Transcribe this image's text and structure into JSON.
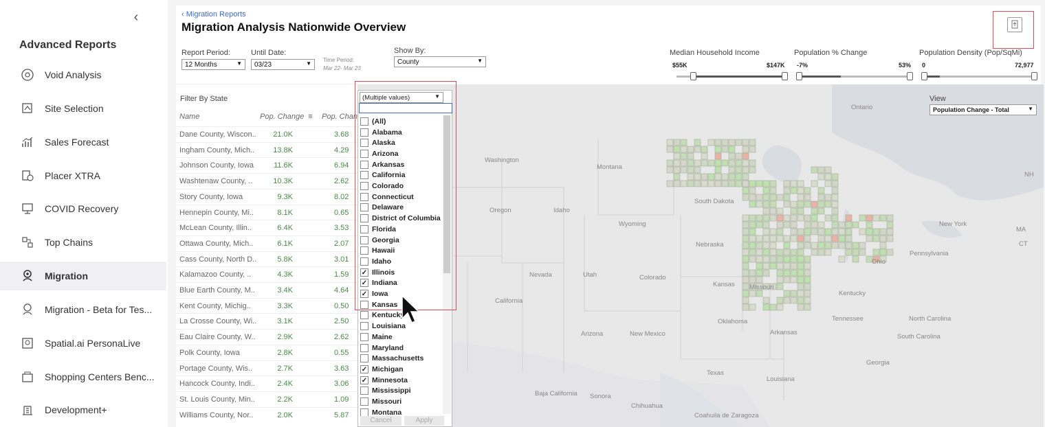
{
  "sidebar": {
    "collapse_glyph": "‹",
    "title": "Advanced Reports",
    "items": [
      {
        "label": "Void Analysis",
        "icon": "void-analysis-icon"
      },
      {
        "label": "Site Selection",
        "icon": "site-selection-icon"
      },
      {
        "label": "Sales Forecast",
        "icon": "sales-forecast-icon"
      },
      {
        "label": "Placer XTRA",
        "icon": "placer-xtra-icon"
      },
      {
        "label": "COVID Recovery",
        "icon": "covid-recovery-icon"
      },
      {
        "label": "Top Chains",
        "icon": "top-chains-icon"
      },
      {
        "label": "Migration",
        "icon": "migration-icon",
        "active": true
      },
      {
        "label": "Migration - Beta for Tes...",
        "icon": "migration-beta-icon"
      },
      {
        "label": "Spatial.ai PersonaLive",
        "icon": "persona-icon"
      },
      {
        "label": "Shopping Centers Benc...",
        "icon": "shopping-centers-icon"
      },
      {
        "label": "Development+",
        "icon": "development-icon"
      }
    ]
  },
  "header": {
    "back_label": "‹ Migration Reports",
    "title": "Migration Analysis  Nationwide Overview"
  },
  "controls": {
    "report_period_label": "Report Period:",
    "report_period_value": "12 Months",
    "until_date_label": "Until Date:",
    "until_date_value": "03/23",
    "time_period_label": "Time Period:",
    "time_period_value": "Mar 22- Mar 23",
    "show_by_label": "Show By:",
    "show_by_value": "County",
    "income_label": "Median Household Income",
    "income_min": "$55K",
    "income_max": "$147K",
    "pop_change_label": "Population % Change",
    "pop_change_min": "-7%",
    "pop_change_max": "53%",
    "density_label": "Population Density (Pop/SqMi)",
    "density_min": "0",
    "density_max": "72,977"
  },
  "filter": {
    "label": "Filter By State"
  },
  "table": {
    "col_name": "Name",
    "col_change": "Pop. Change",
    "col_pct": "Pop. Chang",
    "rows": [
      {
        "name": "Dane County, Wiscon..",
        "change": "21.0K",
        "pct": "3.68"
      },
      {
        "name": "Ingham County, Mich..",
        "change": "13.8K",
        "pct": "4.29"
      },
      {
        "name": "Johnson County, Iowa",
        "change": "11.6K",
        "pct": "6.94"
      },
      {
        "name": "Washtenaw County, ..",
        "change": "10.3K",
        "pct": "2.62"
      },
      {
        "name": "Story County, Iowa",
        "change": "9.3K",
        "pct": "8.02"
      },
      {
        "name": "Hennepin County, Mi..",
        "change": "8.1K",
        "pct": "0.65"
      },
      {
        "name": "McLean County, Illin..",
        "change": "6.4K",
        "pct": "3.53"
      },
      {
        "name": "Ottawa County, Mich..",
        "change": "6.1K",
        "pct": "2.07"
      },
      {
        "name": "Cass County, North D..",
        "change": "5.8K",
        "pct": "3.01"
      },
      {
        "name": "Kalamazoo County, ..",
        "change": "4.3K",
        "pct": "1.59"
      },
      {
        "name": "Blue Earth County, M..",
        "change": "3.4K",
        "pct": "4.64"
      },
      {
        "name": "Kent County, Michig..",
        "change": "3.3K",
        "pct": "0.50"
      },
      {
        "name": "La Crosse County, Wi..",
        "change": "3.1K",
        "pct": "2.50"
      },
      {
        "name": "Eau Claire County, W..",
        "change": "2.9K",
        "pct": "2.62"
      },
      {
        "name": "Polk County, Iowa",
        "change": "2.8K",
        "pct": "0.55"
      },
      {
        "name": "Portage County, Wis..",
        "change": "2.7K",
        "pct": "3.63"
      },
      {
        "name": "Hancock County, Indi..",
        "change": "2.4K",
        "pct": "3.06"
      },
      {
        "name": "St. Louis County, Min..",
        "change": "2.2K",
        "pct": "1.09"
      },
      {
        "name": "Williams County, Nor..",
        "change": "2.0K",
        "pct": "5.87"
      }
    ]
  },
  "dropdown": {
    "value": "(Multiple values)",
    "options": [
      {
        "label": "(All)",
        "checked": false
      },
      {
        "label": "Alabama",
        "checked": false
      },
      {
        "label": "Alaska",
        "checked": false
      },
      {
        "label": "Arizona",
        "checked": false
      },
      {
        "label": "Arkansas",
        "checked": false
      },
      {
        "label": "California",
        "checked": false
      },
      {
        "label": "Colorado",
        "checked": false
      },
      {
        "label": "Connecticut",
        "checked": false
      },
      {
        "label": "Delaware",
        "checked": false
      },
      {
        "label": "District of Columbia",
        "checked": false
      },
      {
        "label": "Florida",
        "checked": false
      },
      {
        "label": "Georgia",
        "checked": false
      },
      {
        "label": "Hawaii",
        "checked": false
      },
      {
        "label": "Idaho",
        "checked": false
      },
      {
        "label": "Illinois",
        "checked": true
      },
      {
        "label": "Indiana",
        "checked": true
      },
      {
        "label": "Iowa",
        "checked": true
      },
      {
        "label": "Kansas",
        "checked": false
      },
      {
        "label": "Kentucky",
        "checked": false
      },
      {
        "label": "Louisiana",
        "checked": false
      },
      {
        "label": "Maine",
        "checked": false
      },
      {
        "label": "Maryland",
        "checked": false
      },
      {
        "label": "Massachusetts",
        "checked": false
      },
      {
        "label": "Michigan",
        "checked": true
      },
      {
        "label": "Minnesota",
        "checked": true
      },
      {
        "label": "Mississippi",
        "checked": false
      },
      {
        "label": "Missouri",
        "checked": false
      },
      {
        "label": "Montana",
        "checked": false
      }
    ],
    "cancel_label": "Cancel",
    "apply_label": "Apply"
  },
  "map": {
    "view_label": "View",
    "view_value": "Population Change - Total",
    "labels": [
      "Ontario",
      "Washington",
      "Montana",
      "Oregon",
      "Idaho",
      "Wyoming",
      "South Dakota",
      "Nebraska",
      "Nevada",
      "Utah",
      "Colorado",
      "Kansas",
      "Missouri",
      "California",
      "Oklahoma",
      "Arkansas",
      "Arizona",
      "New Mexico",
      "Texas",
      "Tennessee",
      "Kentucky",
      "Ohio",
      "Pennsylvania",
      "New York",
      "North Carolina",
      "South Carolina",
      "Georgia",
      "Louisiana",
      "Sonora",
      "Chihuahua",
      "Baja California",
      "Coahuila de Zaragoza",
      "NH",
      "MA",
      "CT"
    ]
  }
}
